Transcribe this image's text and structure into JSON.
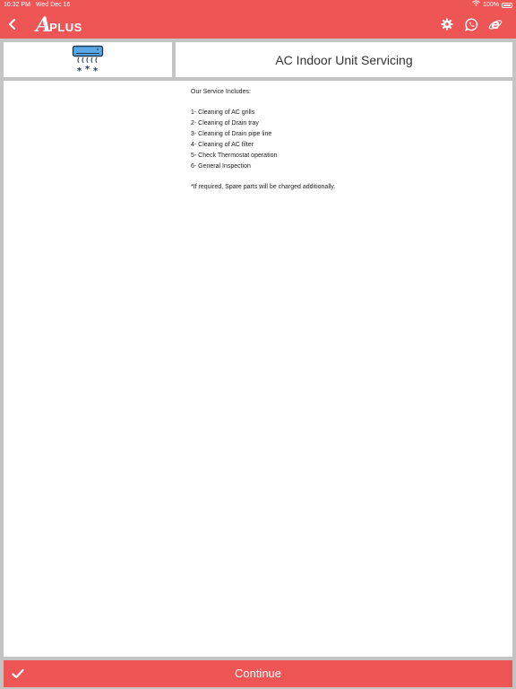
{
  "status_bar": {
    "time": "10:32 PM",
    "date": "Wed Dec 16",
    "battery": "100%",
    "icons": [
      "wifi-icon",
      "battery-icon"
    ]
  },
  "header": {
    "logo_letter": "A",
    "logo_rest": "PLUS",
    "back_icon": "chevron-left-icon",
    "action_icons": [
      "settings-icon",
      "whatsapp-icon",
      "internet-explorer-icon"
    ]
  },
  "service": {
    "icon": "air-conditioner-icon",
    "title": "AC Indoor Unit Servicing"
  },
  "description": {
    "heading": "Our Service Includes:",
    "items": [
      "1- Cleaning of AC grills",
      "2- Cleaning of Drain tray",
      "3- Cleaning of Drain pipe line",
      "4- Cleaning of AC filter",
      "5- Check Thermostat operation",
      "6- General Inspection"
    ],
    "note": "*If required, Spare parts will be charged additionally."
  },
  "footer": {
    "continue_label": "Continue",
    "check_icon": "checkmark-icon"
  },
  "colors": {
    "brand": "#ee5656",
    "background": "#c4c4c4",
    "card": "#ffffff",
    "ac_unit": "#5aa9e6"
  }
}
